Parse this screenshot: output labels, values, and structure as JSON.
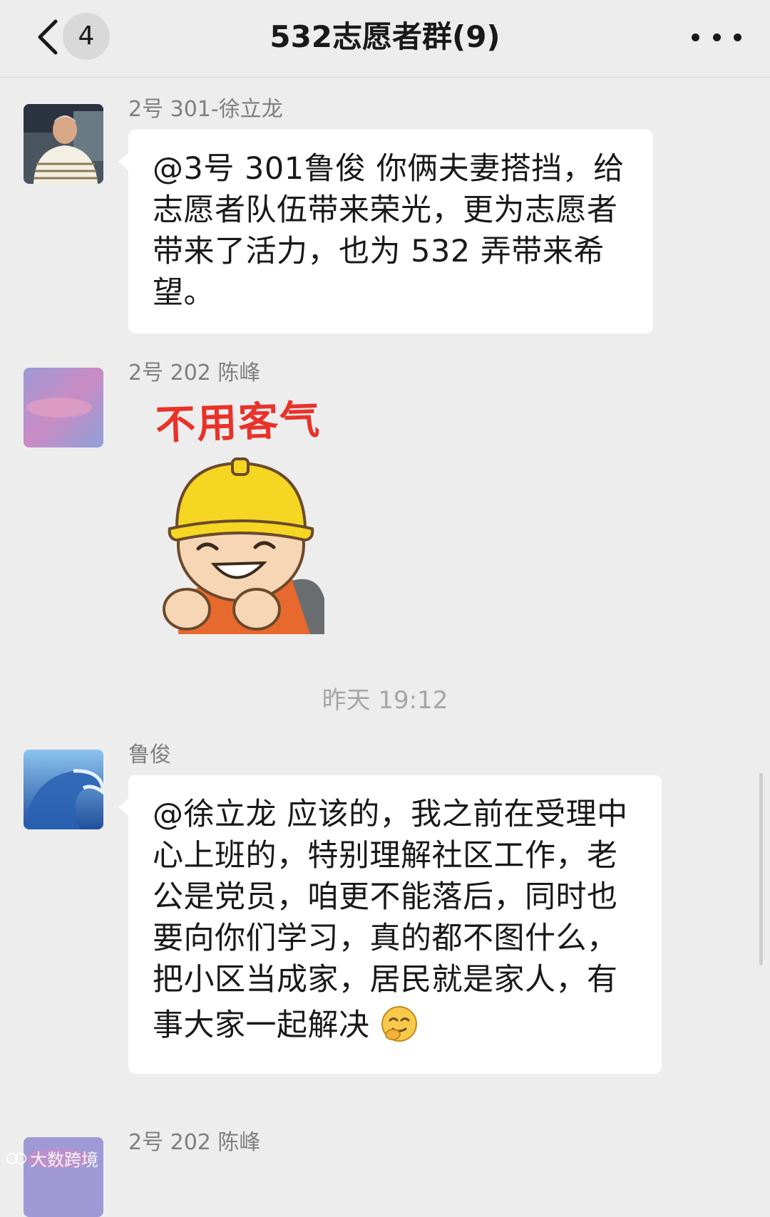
{
  "header": {
    "unread_count": "4",
    "title": "532志愿者群(9)"
  },
  "messages": [
    {
      "sender": "2号 301-徐立龙",
      "text": "@3号 301鲁俊 你俩夫妻搭挡，给志愿者队伍带来荣光，更为志愿者带来了活力，也为 532 弄带来希望。"
    },
    {
      "sender": "2号 202 陈峰",
      "sticker_caption": "不用客气",
      "sticker_icon": "helmet-worker-sticker"
    },
    {
      "sender": "鲁俊",
      "text": "@徐立龙 应该的，我之前在受理中心上班的，特别理解社区工作，老公是党员，咱更不能落后，同时也要向你们学习，真的都不图什么，把小区当成家，居民就是家人，有事大家一起解决",
      "emoji": "smile-emoji"
    },
    {
      "sender": "2号 202 陈峰"
    }
  ],
  "timestamp": "昨天 19:12",
  "watermark": "大数跨境",
  "colors": {
    "background": "#ededed",
    "bubble": "#ffffff",
    "sender_text": "#7f7f7f",
    "sticker_caption": "#e8322a",
    "helmet": "#f5d623"
  }
}
